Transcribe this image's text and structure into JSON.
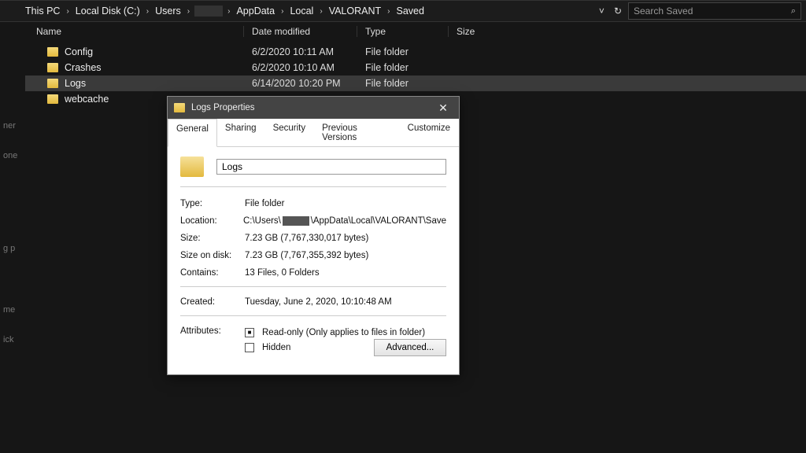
{
  "breadcrumb": {
    "items": [
      "This PC",
      "Local Disk (C:)",
      "Users",
      "",
      "AppData",
      "Local",
      "VALORANT",
      "Saved"
    ],
    "obscured_index": 3
  },
  "toolbar": {
    "refresh": "↻",
    "history_dd": "˅"
  },
  "search": {
    "placeholder": "Search Saved"
  },
  "columns": {
    "name": "Name",
    "date": "Date modified",
    "type": "Type",
    "size": "Size"
  },
  "rows": [
    {
      "name": "Config",
      "date": "6/2/2020 10:11 AM",
      "type": "File folder",
      "selected": false
    },
    {
      "name": "Crashes",
      "date": "6/2/2020 10:10 AM",
      "type": "File folder",
      "selected": false
    },
    {
      "name": "Logs",
      "date": "6/14/2020 10:20 PM",
      "type": "File folder",
      "selected": true
    },
    {
      "name": "webcache",
      "date": "",
      "type": "",
      "selected": false
    }
  ],
  "nav_stubs": [
    "ner",
    "one",
    "g p",
    "me",
    "ick"
  ],
  "dialog": {
    "title": "Logs Properties",
    "tabs": {
      "general": "General",
      "sharing": "Sharing",
      "security": "Security",
      "prev": "Previous Versions",
      "custom": "Customize"
    },
    "name_value": "Logs",
    "type_label": "Type:",
    "type_value": "File folder",
    "location_label": "Location:",
    "location_prefix": "C:\\Users\\",
    "location_suffix": "\\AppData\\Local\\VALORANT\\Save",
    "size_label": "Size:",
    "size_value": "7.23 GB (7,767,330,017 bytes)",
    "sod_label": "Size on disk:",
    "sod_value": "7.23 GB (7,767,355,392 bytes)",
    "contains_label": "Contains:",
    "contains_value": "13 Files, 0 Folders",
    "created_label": "Created:",
    "created_value": "Tuesday, June 2, 2020, 10:10:48 AM",
    "attr_label": "Attributes:",
    "readonly_label": "Read-only (Only applies to files in folder)",
    "hidden_label": "Hidden",
    "advanced_label": "Advanced..."
  }
}
